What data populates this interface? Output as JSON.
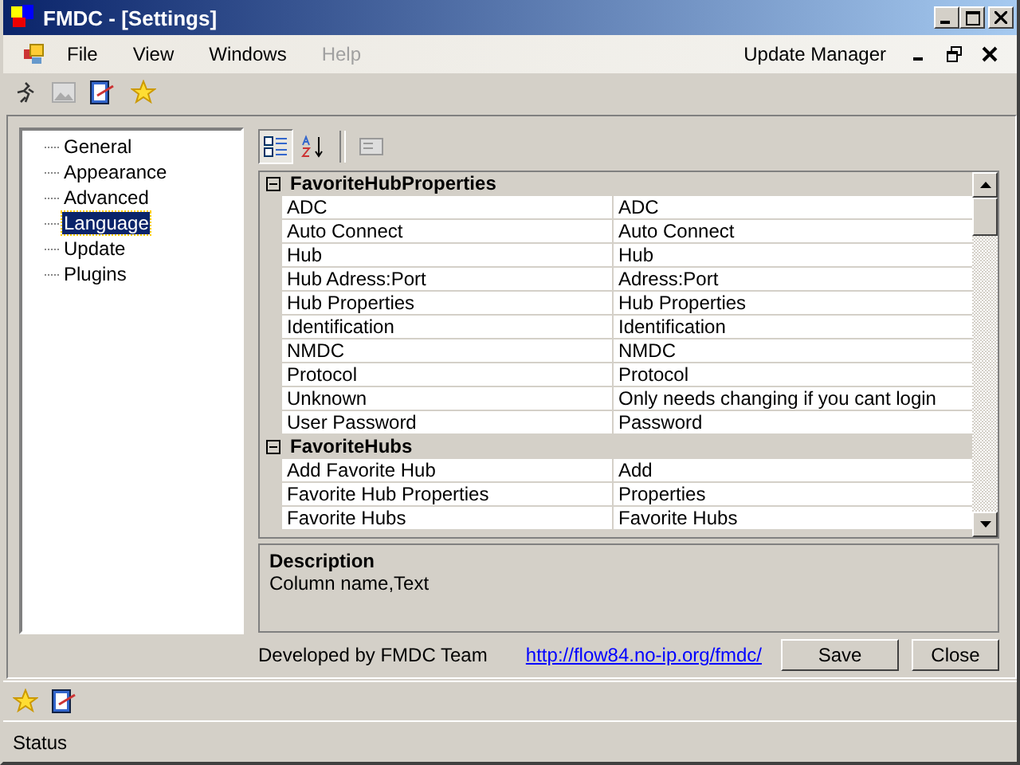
{
  "window": {
    "title": "FMDC - [Settings]"
  },
  "menu": [
    {
      "label": "File",
      "disabled": false
    },
    {
      "label": "View",
      "disabled": false
    },
    {
      "label": "Windows",
      "disabled": false
    },
    {
      "label": "Help",
      "disabled": true
    }
  ],
  "menu_right": {
    "label": "Update Manager"
  },
  "tree": [
    {
      "label": "General",
      "selected": false
    },
    {
      "label": "Appearance",
      "selected": false
    },
    {
      "label": "Advanced",
      "selected": false
    },
    {
      "label": "Language",
      "selected": true
    },
    {
      "label": "Update",
      "selected": false
    },
    {
      "label": "Plugins",
      "selected": false
    }
  ],
  "grid": {
    "categories": [
      {
        "name": "FavoriteHubProperties",
        "expanded": true,
        "rows": [
          {
            "name": "ADC",
            "value": "ADC"
          },
          {
            "name": "Auto Connect",
            "value": "Auto Connect"
          },
          {
            "name": "Hub",
            "value": "Hub"
          },
          {
            "name": "Hub Adress:Port",
            "value": "Adress:Port"
          },
          {
            "name": "Hub Properties",
            "value": "Hub Properties"
          },
          {
            "name": "Identification",
            "value": "Identification"
          },
          {
            "name": "NMDC",
            "value": "NMDC"
          },
          {
            "name": "Protocol",
            "value": "Protocol"
          },
          {
            "name": "Unknown",
            "value": "Only needs changing if you cant login"
          },
          {
            "name": "User Password",
            "value": "Password"
          }
        ]
      },
      {
        "name": "FavoriteHubs",
        "expanded": true,
        "rows": [
          {
            "name": "Add Favorite Hub",
            "value": "Add"
          },
          {
            "name": "Favorite Hub Properties",
            "value": "Properties"
          },
          {
            "name": "Favorite Hubs",
            "value": "Favorite Hubs"
          }
        ]
      }
    ]
  },
  "description": {
    "title": "Description",
    "text": "Column name,Text"
  },
  "footer": {
    "credit": "Developed by FMDC Team",
    "link": "http://flow84.no-ip.org/fmdc/",
    "buttons": [
      "Save",
      "Close"
    ]
  },
  "status_bar": {
    "text": "Status"
  }
}
